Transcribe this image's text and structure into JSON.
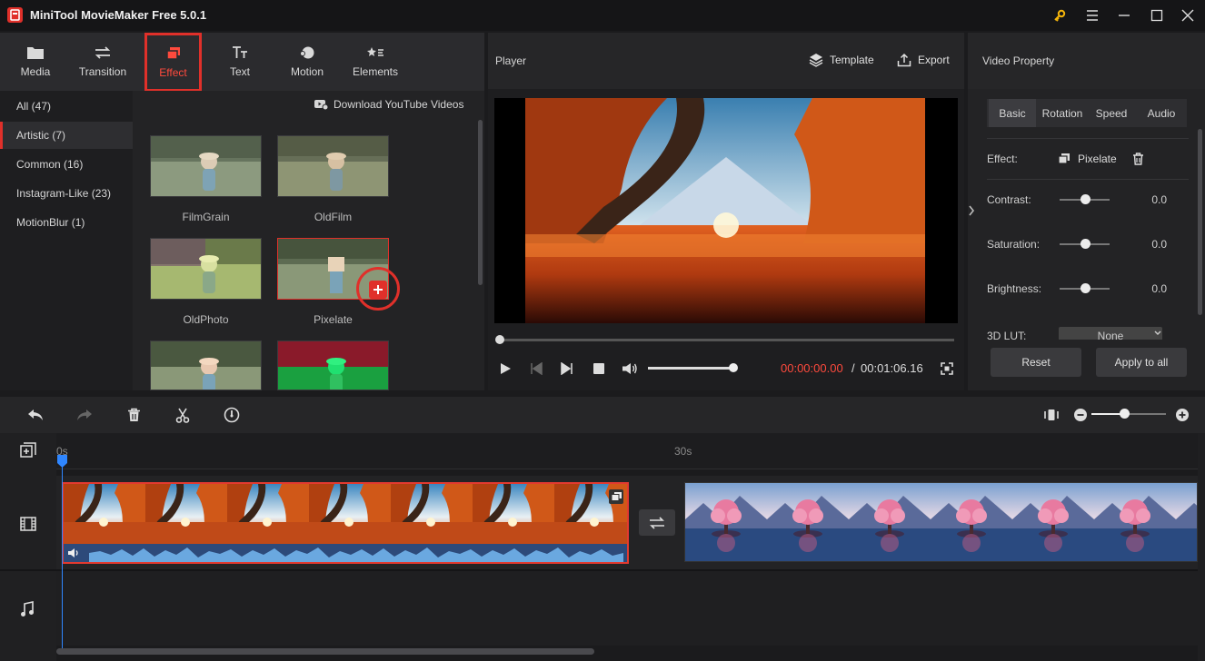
{
  "app": {
    "title": "MiniTool MovieMaker Free 5.0.1"
  },
  "toolbar": {
    "tools": [
      {
        "label": "Media",
        "icon": "folder-icon"
      },
      {
        "label": "Transition",
        "icon": "swap-arrows-icon"
      },
      {
        "label": "Effect",
        "icon": "layers-icon"
      },
      {
        "label": "Text",
        "icon": "text-icon"
      },
      {
        "label": "Motion",
        "icon": "motion-icon"
      },
      {
        "label": "Elements",
        "icon": "stars-icon"
      }
    ],
    "selected": "Effect"
  },
  "categories": [
    {
      "label": "All (47)"
    },
    {
      "label": "Artistic (7)"
    },
    {
      "label": "Common (16)"
    },
    {
      "label": "Instagram-Like (23)"
    },
    {
      "label": "MotionBlur (1)"
    }
  ],
  "download_youtube": "Download YouTube Videos",
  "effects": [
    {
      "label": "FilmGrain"
    },
    {
      "label": "OldFilm"
    },
    {
      "label": "OldPhoto"
    },
    {
      "label": "Pixelate"
    }
  ],
  "player": {
    "title": "Player",
    "template_label": "Template",
    "export_label": "Export",
    "time_current": "00:00:00.00",
    "time_sep": "/",
    "time_total": "00:01:06.16",
    "volume": 0.9,
    "progress": 0.0
  },
  "property": {
    "title": "Video Property",
    "tabs": [
      "Basic",
      "Rotation",
      "Speed",
      "Audio"
    ],
    "effect_label": "Effect:",
    "effect_value": "Pixelate",
    "contrast_label": "Contrast:",
    "contrast_value": "0.0",
    "saturation_label": "Saturation:",
    "saturation_value": "0.0",
    "brightness_label": "Brightness:",
    "brightness_value": "0.0",
    "lut_label": "3D LUT:",
    "lut_value": "None",
    "reset_label": "Reset",
    "apply_all_label": "Apply to all"
  },
  "timeline": {
    "ruler": [
      "0s",
      "30s"
    ],
    "zoom": 0.45
  },
  "colors": {
    "accent": "#e0302a",
    "playhead": "#2f86ff",
    "time_current": "#ff4a3d"
  }
}
